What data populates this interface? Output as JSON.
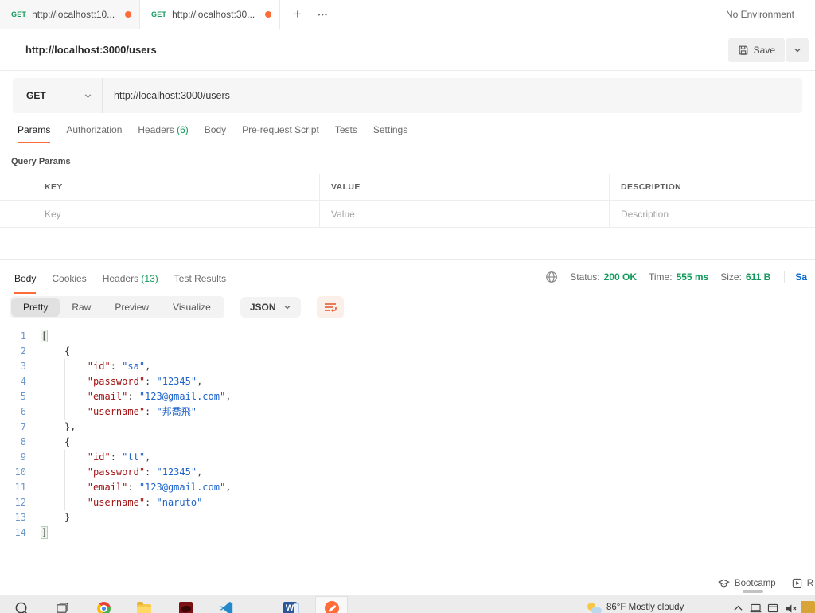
{
  "colors": {
    "accent": "#ff6c37",
    "green": "#139a5c",
    "link_blue": "#0265d2",
    "code_key": "#a31515",
    "code_string": "#1e63c9",
    "line_number": "#6a96c8"
  },
  "tabbar": {
    "tabs": [
      {
        "method": "GET",
        "title": "http://localhost:10..."
      },
      {
        "method": "GET",
        "title": "http://localhost:30..."
      }
    ],
    "add_tab": "+",
    "more_tabs": "•••",
    "environment": "No Environment"
  },
  "request": {
    "title": "http://localhost:3000/users",
    "save_label": "Save",
    "method": "GET",
    "url": "http://localhost:3000/users",
    "tabs": {
      "params": "Params",
      "authorization": "Authorization",
      "headers": "Headers",
      "headers_count": "(6)",
      "body": "Body",
      "prerequest": "Pre-request Script",
      "tests": "Tests",
      "settings": "Settings"
    },
    "query_params_label": "Query Params",
    "table": {
      "headers": {
        "key": "KEY",
        "value": "VALUE",
        "description": "DESCRIPTION"
      },
      "placeholders": {
        "key": "Key",
        "value": "Value",
        "description": "Description"
      }
    }
  },
  "response": {
    "tabs": {
      "body": "Body",
      "cookies": "Cookies",
      "headers": "Headers",
      "headers_count": "(13)",
      "test_results": "Test Results"
    },
    "meta": {
      "status_label": "Status:",
      "status_value": "200 OK",
      "time_label": "Time:",
      "time_value": "555 ms",
      "size_label": "Size:",
      "size_value": "611 B",
      "save_truncated": "Sa"
    },
    "view_modes": {
      "pretty": "Pretty",
      "raw": "Raw",
      "preview": "Preview",
      "visualize": "Visualize"
    },
    "format": "JSON",
    "code_lines": [
      {
        "n": 1,
        "tokens": [
          [
            "bhl",
            "["
          ]
        ]
      },
      {
        "n": 2,
        "tokens": [
          [
            "p",
            "    "
          ],
          [
            "br",
            "{"
          ]
        ]
      },
      {
        "n": 3,
        "guide": true,
        "tokens": [
          [
            "p",
            "        "
          ],
          [
            "k",
            "\"id\""
          ],
          [
            "p",
            ": "
          ],
          [
            "s",
            "\"sa\""
          ],
          [
            "p",
            ","
          ]
        ]
      },
      {
        "n": 4,
        "guide": true,
        "tokens": [
          [
            "p",
            "        "
          ],
          [
            "k",
            "\"password\""
          ],
          [
            "p",
            ": "
          ],
          [
            "s",
            "\"12345\""
          ],
          [
            "p",
            ","
          ]
        ]
      },
      {
        "n": 5,
        "guide": true,
        "tokens": [
          [
            "p",
            "        "
          ],
          [
            "k",
            "\"email\""
          ],
          [
            "p",
            ": "
          ],
          [
            "s",
            "\"123@gmail.com\""
          ],
          [
            "p",
            ","
          ]
        ]
      },
      {
        "n": 6,
        "guide": true,
        "tokens": [
          [
            "p",
            "        "
          ],
          [
            "k",
            "\"username\""
          ],
          [
            "p",
            ": "
          ],
          [
            "s",
            "\"邦喬飛\""
          ]
        ]
      },
      {
        "n": 7,
        "tokens": [
          [
            "p",
            "    "
          ],
          [
            "br",
            "},"
          ]
        ]
      },
      {
        "n": 8,
        "tokens": [
          [
            "p",
            "    "
          ],
          [
            "br",
            "{"
          ]
        ]
      },
      {
        "n": 9,
        "guide": true,
        "tokens": [
          [
            "p",
            "        "
          ],
          [
            "k",
            "\"id\""
          ],
          [
            "p",
            ": "
          ],
          [
            "s",
            "\"tt\""
          ],
          [
            "p",
            ","
          ]
        ]
      },
      {
        "n": 10,
        "guide": true,
        "tokens": [
          [
            "p",
            "        "
          ],
          [
            "k",
            "\"password\""
          ],
          [
            "p",
            ": "
          ],
          [
            "s",
            "\"12345\""
          ],
          [
            "p",
            ","
          ]
        ]
      },
      {
        "n": 11,
        "guide": true,
        "tokens": [
          [
            "p",
            "        "
          ],
          [
            "k",
            "\"email\""
          ],
          [
            "p",
            ": "
          ],
          [
            "s",
            "\"123@gmail.com\""
          ],
          [
            "p",
            ","
          ]
        ]
      },
      {
        "n": 12,
        "guide": true,
        "tokens": [
          [
            "p",
            "        "
          ],
          [
            "k",
            "\"username\""
          ],
          [
            "p",
            ": "
          ],
          [
            "s",
            "\"naruto\""
          ]
        ]
      },
      {
        "n": 13,
        "tokens": [
          [
            "p",
            "    "
          ],
          [
            "br",
            "}"
          ]
        ]
      },
      {
        "n": 14,
        "tokens": [
          [
            "bhl",
            "]"
          ]
        ]
      }
    ]
  },
  "footer": {
    "bootcamp": "Bootcamp",
    "runner_truncated": "R"
  },
  "taskbar": {
    "weather": "86°F  Mostly cloudy"
  },
  "icons": [
    "save-icon",
    "chevron-down-icon",
    "globe-icon",
    "wrap-line-icon",
    "graduation-cap-icon",
    "runner-icon",
    "unsaved-changes-dot",
    "search-icon",
    "task-view-icon",
    "chrome-icon",
    "file-explorer-icon",
    "red-app-icon",
    "vscode-icon",
    "word-icon",
    "postman-icon",
    "weather-icon",
    "tray-chevron-up-icon",
    "tray-device-icon",
    "tray-window-icon",
    "volume-muted-icon",
    "edge-tray-icon"
  ]
}
